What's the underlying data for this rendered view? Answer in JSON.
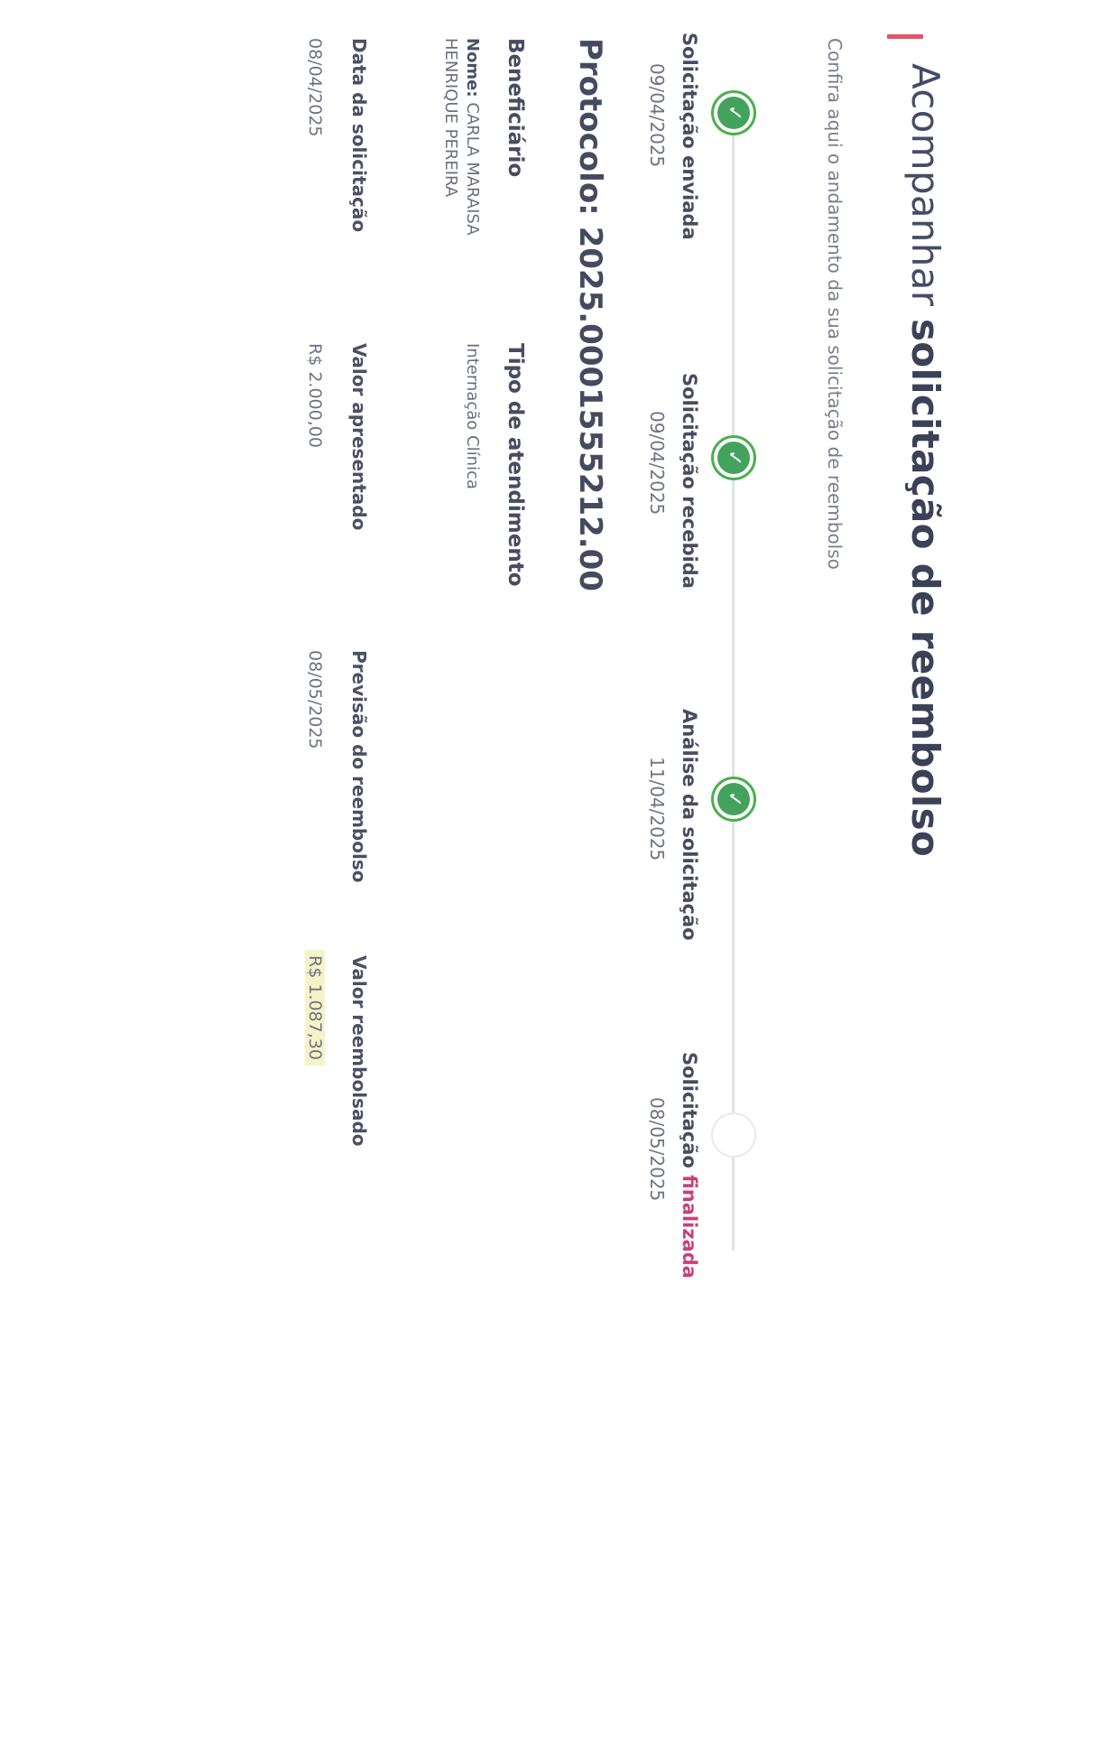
{
  "header": {
    "title_light": "Acompanhar ",
    "title_bold": "solicitação de reembolso",
    "subtitle": "Confira aqui o andamento da sua solicitação de reembolso"
  },
  "steps": [
    {
      "label": "Solicitação enviada",
      "date": "09/04/2025",
      "done": true
    },
    {
      "label": "Solicitação recebida",
      "date": "09/04/2025",
      "done": true
    },
    {
      "label": "Análise da solicitação",
      "date": "11/04/2025",
      "done": true
    },
    {
      "label_a": "Solicitação ",
      "label_b": "finalizada",
      "date": "08/05/2025",
      "done": false
    }
  ],
  "check_glyph": "✓",
  "protocol": "Protocolo: 2025.0001555212.00",
  "beneficiary": {
    "heading": "Beneficiário",
    "name_label": "Nome:",
    "name_value": "CARLA MARAISA HENRIQUE PEREIRA"
  },
  "service_type": {
    "heading": "Tipo de atendimento",
    "value": "Internação Clínica"
  },
  "fields": {
    "request_date": {
      "label": "Data da solicitação",
      "value": "08/04/2025"
    },
    "presented_value": {
      "label": "Valor apresentado",
      "value": "R$ 2.000,00"
    },
    "refund_forecast": {
      "label": "Previsão do reembolso",
      "value": "08/05/2025"
    },
    "refunded_value": {
      "label": "Valor reembolsado",
      "value": "R$ 1.087,30"
    }
  },
  "colors": {
    "accent": "#e0566a",
    "success": "#43a35c",
    "highlight": "#f6f3c8"
  },
  "icons": [
    "check-circle-icon",
    "pending-circle-icon"
  ]
}
